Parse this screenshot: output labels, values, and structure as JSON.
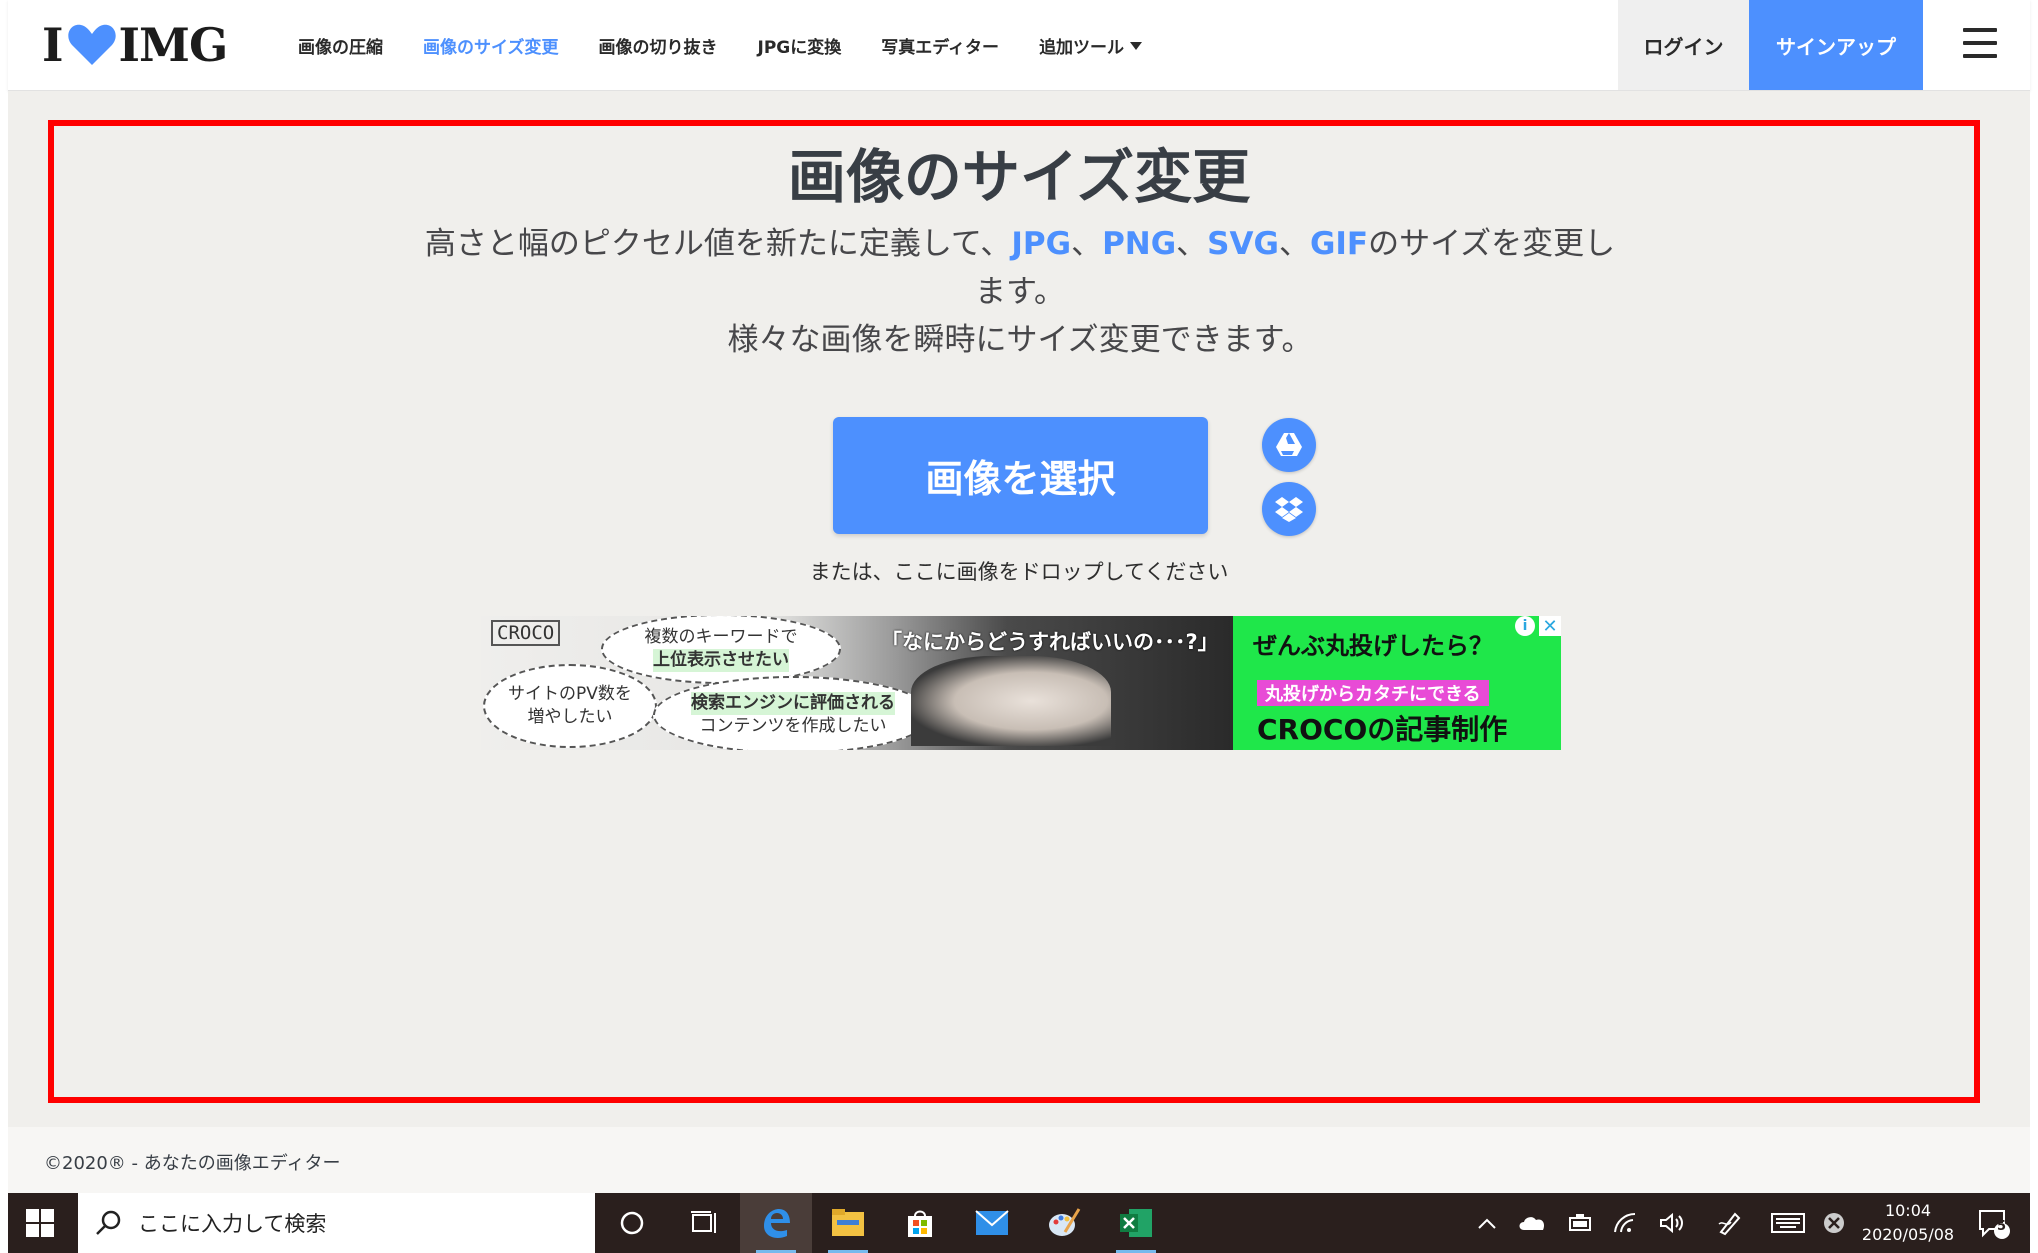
{
  "header": {
    "logo": {
      "left": "I",
      "right": "IMG"
    },
    "nav": [
      {
        "label": "画像の圧縮",
        "active": false
      },
      {
        "label": "画像のサイズ変更",
        "active": true
      },
      {
        "label": "画像の切り抜き",
        "active": false
      },
      {
        "label": "JPGに変換",
        "active": false
      },
      {
        "label": "写真エディター",
        "active": false
      },
      {
        "label": "追加ツール",
        "active": false,
        "dropdown": true
      }
    ],
    "login_label": "ログイン",
    "signup_label": "サインアップ",
    "menu_icon": "hamburger-icon"
  },
  "main": {
    "title": "画像のサイズ変更",
    "subtitle": {
      "pre": "高さと幅のピクセル値を新たに定義して、",
      "formats": [
        "JPG",
        "PNG",
        "SVG",
        "GIF"
      ],
      "sep": "、",
      "post": "のサイズを変更します。",
      "line2": "様々な画像を瞬時にサイズ変更できます。"
    },
    "select_button": "画像を選択",
    "cloud_icons": [
      "google-drive-icon",
      "dropbox-icon"
    ],
    "drop_hint": "または、ここに画像をドロップしてください"
  },
  "ad": {
    "brand": "CROCO",
    "bubbles": [
      {
        "line1": "複数のキーワードで",
        "line2": "上位表示させたい"
      },
      {
        "line1": "サイトのPV数を",
        "line2": "増やしたい"
      },
      {
        "line1": "検索エンジンに評価される",
        "line2": "コンテンツを作成したい"
      }
    ],
    "quote": "「なにからどうすればいいの･･･?」",
    "right_line1": "ぜんぶ丸投げしたら？",
    "right_line2": "丸投げからカタチにできる",
    "right_line3": "CROCOの記事制作",
    "info": "i",
    "close": "✕"
  },
  "footer": {
    "copyright": "©2020® - あなたの画像エディター"
  },
  "taskbar": {
    "search_placeholder": "ここに入力して検索",
    "apps": [
      "cortana-icon",
      "task-view-icon",
      "edge-icon",
      "file-explorer-icon",
      "store-icon",
      "mail-icon",
      "paint-icon",
      "excel-icon"
    ],
    "active_app": "edge-icon",
    "time": "10:04",
    "date": "2020/05/08",
    "notification_count": "5"
  },
  "colors": {
    "accent": "#4d90fe",
    "frame": "#ff0000",
    "background": "#f0efec",
    "ad_green": "#1fe74a",
    "taskbar": "#2a1f1d"
  }
}
